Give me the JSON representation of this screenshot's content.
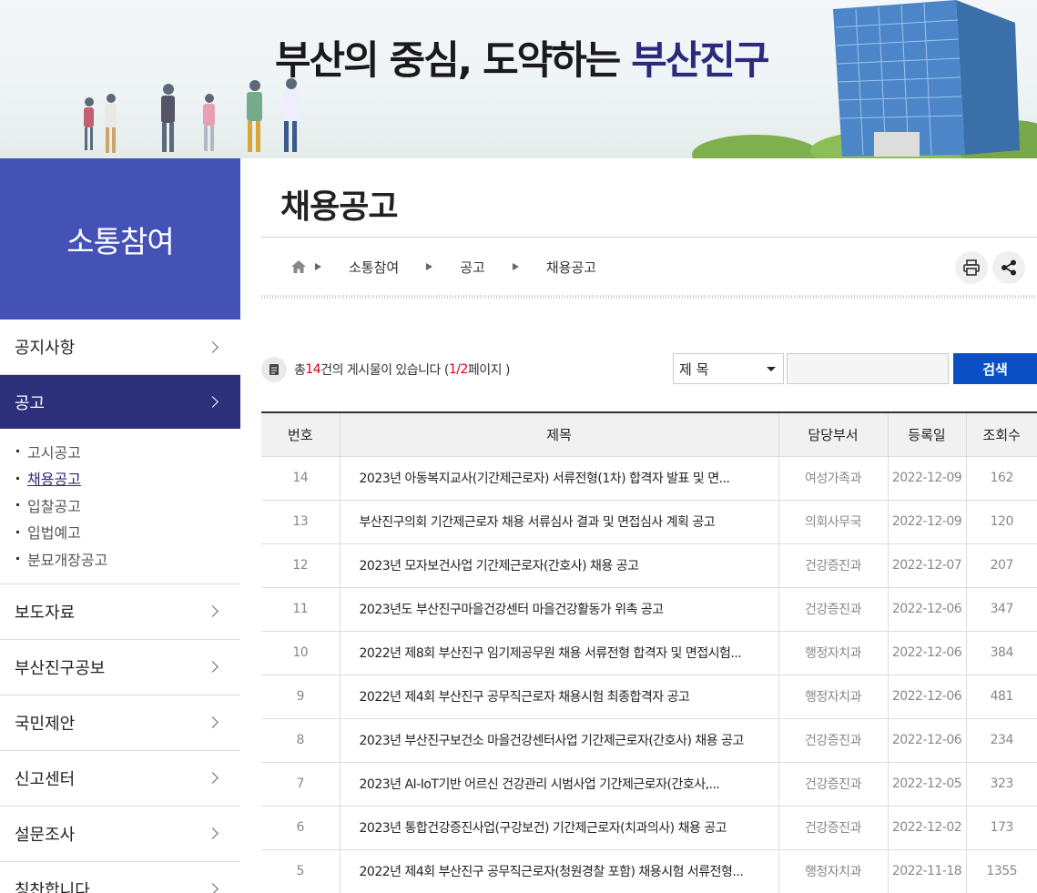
{
  "banner": {
    "title_main": "부산의 중심, 도약하는 ",
    "title_accent": "부산진구"
  },
  "sidebar": {
    "heading": "소통참여",
    "items": [
      {
        "label": "공지사항"
      },
      {
        "label": "공고"
      },
      {
        "label": "보도자료"
      },
      {
        "label": "부산진구공보"
      },
      {
        "label": "국민제안"
      },
      {
        "label": "신고센터"
      },
      {
        "label": "설문조사"
      },
      {
        "label": "칭찬합니다"
      }
    ],
    "sub_items": [
      {
        "label": "고시공고"
      },
      {
        "label": "채용공고"
      },
      {
        "label": "입찰공고"
      },
      {
        "label": "입법예고"
      },
      {
        "label": "분묘개장공고"
      }
    ]
  },
  "main": {
    "page_title": "채용공고",
    "breadcrumb": [
      "소통참여",
      "공고",
      "채용공고"
    ]
  },
  "board": {
    "count_prefix": "총 ",
    "count": "14",
    "count_mid": "건의 게시물이 있습니다 ( ",
    "page_current": "1",
    "page_sep": "/2",
    "count_suffix": " 페이지 )",
    "search_select": "제 목",
    "search_input": "",
    "search_button": "검색",
    "columns": [
      "번호",
      "제목",
      "담당부서",
      "등록일",
      "조회수"
    ],
    "rows": [
      {
        "no": "14",
        "title": "2023년 아동복지교사(기간제근로자) 서류전형(1차) 합격자 발표 및 면...",
        "dept": "여성가족과",
        "date": "2022-12-09",
        "views": "162"
      },
      {
        "no": "13",
        "title": "부산진구의회 기간제근로자 채용 서류심사 결과 및 면접심사 계획 공고",
        "dept": "의회사무국",
        "date": "2022-12-09",
        "views": "120"
      },
      {
        "no": "12",
        "title": "2023년 모자보건사업 기간제근로자(간호사) 채용 공고",
        "dept": "건강증진과",
        "date": "2022-12-07",
        "views": "207"
      },
      {
        "no": "11",
        "title": "2023년도 부산진구마을건강센터 마을건강활동가 위촉 공고",
        "dept": "건강증진과",
        "date": "2022-12-06",
        "views": "347"
      },
      {
        "no": "10",
        "title": "2022년 제8회 부산진구 임기제공무원 채용 서류전형 합격자 및 면접시험...",
        "dept": "행정자치과",
        "date": "2022-12-06",
        "views": "384"
      },
      {
        "no": "9",
        "title": "2022년 제4회 부산진구 공무직근로자 채용시험 최종합격자 공고",
        "dept": "행정자치과",
        "date": "2022-12-06",
        "views": "481"
      },
      {
        "no": "8",
        "title": "2023년 부산진구보건소 마을건강센터사업 기간제근로자(간호사) 채용 공고",
        "dept": "건강증진과",
        "date": "2022-12-06",
        "views": "234"
      },
      {
        "no": "7",
        "title": "2023년 AI-IoT기반 어르신 건강관리 시범사업 기간제근로자(간호사,...",
        "dept": "건강증진과",
        "date": "2022-12-05",
        "views": "323"
      },
      {
        "no": "6",
        "title": "2023년 통합건강증진사업(구강보건) 기간제근로자(치과의사) 채용 공고",
        "dept": "건강증진과",
        "date": "2022-12-02",
        "views": "173"
      },
      {
        "no": "5",
        "title": "2022년 제4회 부산진구 공무직근로자(청원경찰 포함) 채용시험 서류전형...",
        "dept": "행정자치과",
        "date": "2022-11-18",
        "views": "1355"
      }
    ]
  }
}
